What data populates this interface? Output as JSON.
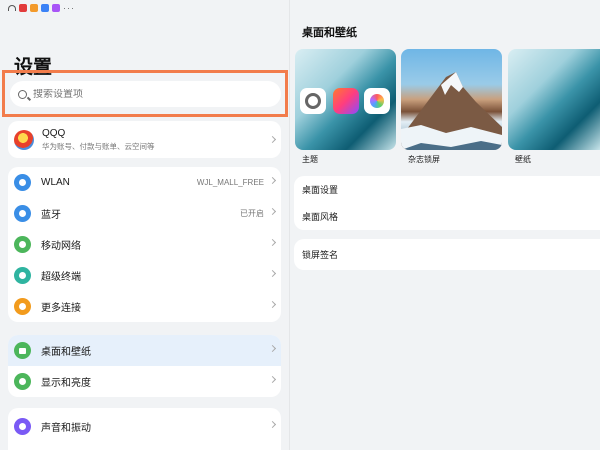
{
  "statusbar": {
    "icon_colors": [
      "#e23b3b",
      "#f39a2b",
      "#3b82f6",
      "#a855f7"
    ]
  },
  "settings": {
    "title": "设置",
    "search_placeholder": "搜索设置项",
    "account": {
      "name": "QQQ",
      "subtitle": "华为账号、付款与账单、云空间等"
    },
    "network_items": [
      {
        "label": "WLAN",
        "value": "WJL_MALL_FREE",
        "icon": "wifi-icon",
        "color": "#3a8ee6"
      },
      {
        "label": "蓝牙",
        "value": "已开启",
        "icon": "bluetooth-icon",
        "color": "#3a8ee6"
      },
      {
        "label": "移动网络",
        "value": "",
        "icon": "mobile-network-icon",
        "color": "#4cb65b"
      },
      {
        "label": "超级终端",
        "value": "",
        "icon": "super-device-icon",
        "color": "#2fb4a0"
      },
      {
        "label": "更多连接",
        "value": "",
        "icon": "more-connections-icon",
        "color": "#f29b1d"
      }
    ],
    "display_items": [
      {
        "label": "桌面和壁纸",
        "icon": "wallpaper-icon",
        "color": "#4cb65b",
        "selected": true
      },
      {
        "label": "显示和亮度",
        "icon": "display-icon",
        "color": "#4cb65b"
      }
    ],
    "sound_items": [
      {
        "label": "声音和振动",
        "icon": "sound-icon",
        "color": "#7a5af5"
      }
    ]
  },
  "detail": {
    "title": "桌面和壁纸",
    "thumbnails": [
      {
        "label": "主题"
      },
      {
        "label": "杂志锁屏"
      },
      {
        "label": "壁纸"
      }
    ],
    "group1": [
      "桌面设置",
      "桌面风格"
    ],
    "group2": [
      "锁屏签名"
    ]
  }
}
